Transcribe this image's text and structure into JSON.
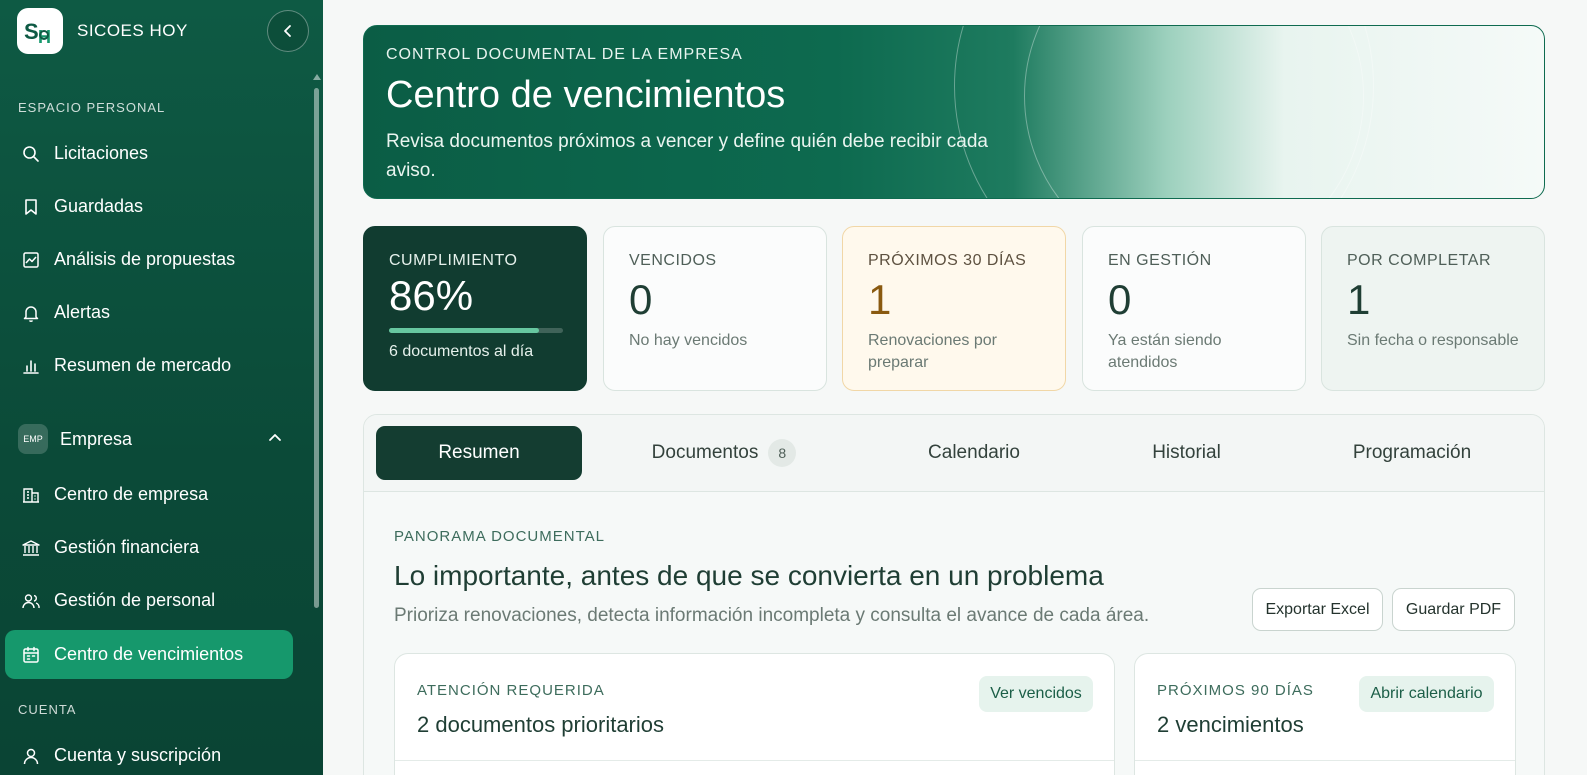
{
  "brand": {
    "name": "SICOES HOY",
    "logo_text": "SH"
  },
  "sidebar": {
    "personal_label": "ESPACIO PERSONAL",
    "personal_items": [
      {
        "label": "Licitaciones",
        "icon": "search-icon"
      },
      {
        "label": "Guardadas",
        "icon": "bookmark-icon"
      },
      {
        "label": "Análisis de propuestas",
        "icon": "chart-line-icon"
      },
      {
        "label": "Alertas",
        "icon": "bell-icon"
      },
      {
        "label": "Resumen de mercado",
        "icon": "bar-chart-icon"
      }
    ],
    "company_group": {
      "badge": "EMP",
      "label": "Empresa",
      "expanded": true
    },
    "company_items": [
      {
        "label": "Centro de empresa",
        "icon": "building-icon"
      },
      {
        "label": "Gestión financiera",
        "icon": "bank-icon"
      },
      {
        "label": "Gestión de personal",
        "icon": "users-icon"
      },
      {
        "label": "Centro de vencimientos",
        "icon": "calendar-icon",
        "active": true
      }
    ],
    "account_label": "CUENTA",
    "account_items": [
      {
        "label": "Cuenta y suscripción",
        "icon": "user-icon"
      }
    ]
  },
  "hero": {
    "kicker": "CONTROL DOCUMENTAL DE LA EMPRESA",
    "title": "Centro de vencimientos",
    "description": "Revisa documentos próximos a vencer y define quién debe recibir cada aviso."
  },
  "stats": {
    "compliance": {
      "label": "CUMPLIMIENTO",
      "value": "86%",
      "progress": 0.86,
      "sub": "6 documentos al día"
    },
    "expired": {
      "label": "VENCIDOS",
      "value": "0",
      "sub": "No hay vencidos"
    },
    "next30": {
      "label": "PRÓXIMOS 30 DÍAS",
      "value": "1",
      "sub": "Renovaciones por preparar"
    },
    "in_progress": {
      "label": "EN GESTIÓN",
      "value": "0",
      "sub": "Ya están siendo atendidos"
    },
    "to_complete": {
      "label": "POR COMPLETAR",
      "value": "1",
      "sub": "Sin fecha o responsable"
    }
  },
  "tabs": {
    "summary": "Resumen",
    "documents": "Documentos",
    "documents_count": "8",
    "calendar": "Calendario",
    "history": "Historial",
    "schedule": "Programación"
  },
  "overview": {
    "kicker": "PANORAMA DOCUMENTAL",
    "title": "Lo importante, antes de que se convierta en un problema",
    "description": "Prioriza renovaciones, detecta información incompleta y consulta el avance de cada área.",
    "export_excel": "Exportar Excel",
    "save_pdf": "Guardar PDF"
  },
  "attention": {
    "kicker": "ATENCIÓN REQUERIDA",
    "title": "2 documentos prioritarios",
    "button": "Ver vencidos"
  },
  "next90": {
    "kicker": "PRÓXIMOS 90 DÍAS",
    "title": "2 vencimientos",
    "button": "Abrir calendario"
  },
  "colors": {
    "sidebar": "#0e5a44",
    "active": "#16986c",
    "dark_card": "#113c30",
    "accent": "#67c7a0"
  }
}
